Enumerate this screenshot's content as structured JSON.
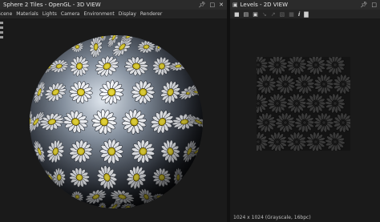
{
  "left_panel": {
    "title": "Sphere 2 Tiles - OpenGL - 3D VIEW",
    "menu": [
      "Scene",
      "Materials",
      "Lights",
      "Camera",
      "Environment",
      "Display",
      "Renderer"
    ]
  },
  "right_panel": {
    "title": "Levels - 2D VIEW",
    "status": "1024 x 1024 (Grayscale, 16bpc)"
  },
  "icons": {
    "pin": "pin-icon",
    "restore": "restore-icon",
    "close": "close-icon"
  },
  "colors": {
    "background": "#1b1b1b",
    "titlebar": "#2b2b2b",
    "daisy_center": "#d8c41e"
  }
}
